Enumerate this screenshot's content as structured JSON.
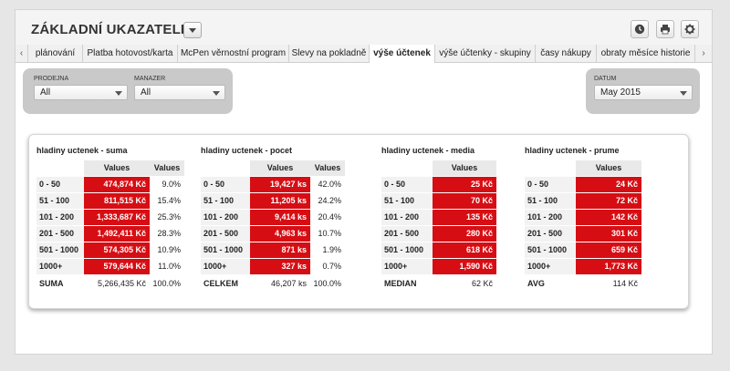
{
  "header": {
    "title": "ZÁKLADNÍ UKAZATELE"
  },
  "tabs": [
    {
      "label": "plánování"
    },
    {
      "label": "Platba hotovost/karta"
    },
    {
      "label": "McPen věrnostní program"
    },
    {
      "label": "Slevy na pokladně"
    },
    {
      "label": "výše účtenek",
      "active": true
    },
    {
      "label": "výše účtenky - skupiny"
    },
    {
      "label": "časy nákupy"
    },
    {
      "label": "obraty měsíce historie"
    }
  ],
  "filters": {
    "prodejna": {
      "label": "PRODEJNA",
      "value": "All"
    },
    "manazer": {
      "label": "MANAZER",
      "value": "All"
    },
    "datum": {
      "label": "DATUM",
      "value": "May 2015"
    }
  },
  "tables": [
    {
      "title": "hladiny uctenek - suma",
      "col1": "Values",
      "col2": "Values",
      "rows": [
        {
          "label": "0 - 50",
          "value": "474,874 Kč",
          "pct": "9.0%"
        },
        {
          "label": "51 - 100",
          "value": "811,515 Kč",
          "pct": "15.4%"
        },
        {
          "label": "101 - 200",
          "value": "1,333,687 Kč",
          "pct": "25.3%"
        },
        {
          "label": "201 - 500",
          "value": "1,492,411 Kč",
          "pct": "28.3%"
        },
        {
          "label": "501 - 1000",
          "value": "574,305 Kč",
          "pct": "10.9%"
        },
        {
          "label": "1000+",
          "value": "579,644 Kč",
          "pct": "11.0%"
        }
      ],
      "total": {
        "label": "SUMA",
        "value": "5,266,435 Kč",
        "pct": "100.0%"
      }
    },
    {
      "title": "hladiny uctenek - pocet",
      "col1": "Values",
      "col2": "Values",
      "rows": [
        {
          "label": "0 - 50",
          "value": "19,427 ks",
          "pct": "42.0%"
        },
        {
          "label": "51 - 100",
          "value": "11,205 ks",
          "pct": "24.2%"
        },
        {
          "label": "101 - 200",
          "value": "9,414 ks",
          "pct": "20.4%"
        },
        {
          "label": "201 - 500",
          "value": "4,963 ks",
          "pct": "10.7%"
        },
        {
          "label": "501 - 1000",
          "value": "871 ks",
          "pct": "1.9%"
        },
        {
          "label": "1000+",
          "value": "327 ks",
          "pct": "0.7%"
        }
      ],
      "total": {
        "label": "CELKEM",
        "value": "46,207 ks",
        "pct": "100.0%"
      }
    },
    {
      "title": "hladiny uctenek - media",
      "col1": "Values",
      "rows": [
        {
          "label": "0 - 50",
          "value": "25 Kč"
        },
        {
          "label": "51 - 100",
          "value": "70 Kč"
        },
        {
          "label": "101 - 200",
          "value": "135 Kč"
        },
        {
          "label": "201 - 500",
          "value": "280 Kč"
        },
        {
          "label": "501 - 1000",
          "value": "618 Kč"
        },
        {
          "label": "1000+",
          "value": "1,590 Kč"
        }
      ],
      "total": {
        "label": "MEDIAN",
        "value": "62 Kč"
      }
    },
    {
      "title": "hladiny uctenek - prume",
      "col1": "Values",
      "rows": [
        {
          "label": "0 - 50",
          "value": "24 Kč"
        },
        {
          "label": "51 - 100",
          "value": "72 Kč"
        },
        {
          "label": "101 - 200",
          "value": "142 Kč"
        },
        {
          "label": "201 - 500",
          "value": "301 Kč"
        },
        {
          "label": "501 - 1000",
          "value": "659 Kč"
        },
        {
          "label": "1000+",
          "value": "1,773 Kč"
        }
      ],
      "total": {
        "label": "AVG",
        "value": "114 Kč"
      }
    }
  ],
  "colors": {
    "accent_red": "#d60e14",
    "filter_bg": "#c9c9c9"
  },
  "icons": [
    "chevron-left-icon",
    "chevron-right-icon",
    "clock-icon",
    "print-icon",
    "gear-icon",
    "chevron-down-icon"
  ]
}
